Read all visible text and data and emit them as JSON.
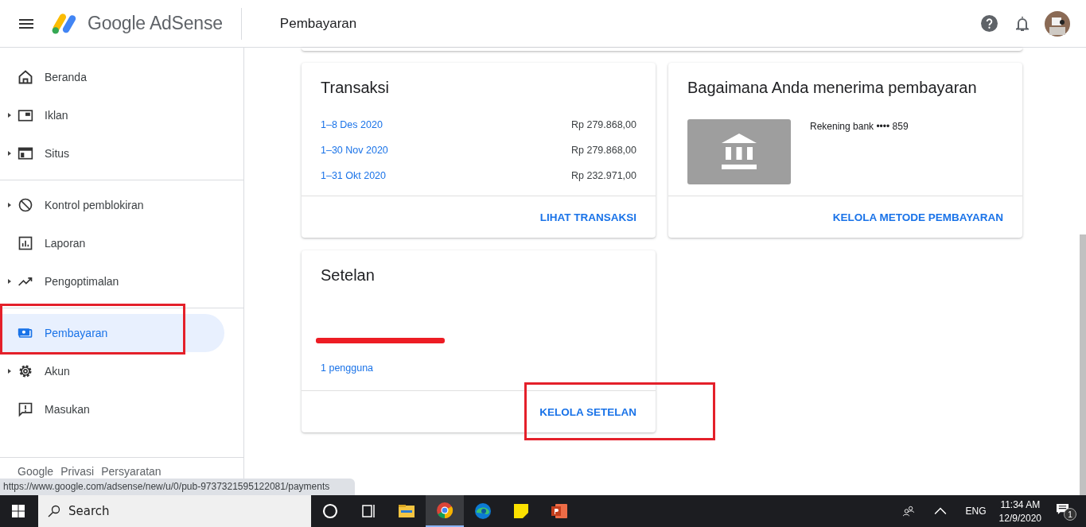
{
  "header": {
    "product": "Google AdSense",
    "page_title": "Pembayaran"
  },
  "sidebar": {
    "sections": [
      [
        {
          "label": "Beranda",
          "kind": "link",
          "selected": false,
          "highlighted": false
        },
        {
          "label": "Iklan",
          "kind": "group",
          "selected": false,
          "highlighted": false
        },
        {
          "label": "Situs",
          "kind": "group",
          "selected": false,
          "highlighted": false
        }
      ],
      [
        {
          "label": "Kontrol pemblokiran",
          "kind": "group",
          "selected": false,
          "highlighted": false
        },
        {
          "label": "Laporan",
          "kind": "link",
          "selected": false,
          "highlighted": false
        },
        {
          "label": "Pengoptimalan",
          "kind": "group",
          "selected": false,
          "highlighted": false
        }
      ],
      [
        {
          "label": "Pembayaran",
          "kind": "link",
          "selected": true,
          "highlighted": true
        },
        {
          "label": "Akun",
          "kind": "group",
          "selected": false,
          "highlighted": false
        },
        {
          "label": "Masukan",
          "kind": "link",
          "selected": false,
          "highlighted": false
        }
      ]
    ],
    "footer_links": [
      "Google",
      "Privasi",
      "Persyaratan"
    ]
  },
  "transactions": {
    "title": "Transaksi",
    "rows": [
      {
        "period": "1–8 Des 2020",
        "amount": "Rp 279.868,00"
      },
      {
        "period": "1–30 Nov 2020",
        "amount": "Rp 279.868,00"
      },
      {
        "period": "1–31 Okt 2020",
        "amount": "Rp 232.971,00"
      }
    ],
    "action": "LIHAT TRANSAKSI"
  },
  "payment_method": {
    "title": "Bagaimana Anda menerima pembayaran",
    "account": "Rekening bank •••• 859",
    "action": "KELOLA METODE PEMBAYARAN"
  },
  "settings": {
    "title": "Setelan",
    "redacted": true,
    "users_link": "1 pengguna",
    "action": "KELOLA SETELAN",
    "action_highlighted": true
  },
  "status_url": "https://www.google.com/adsense/new/u/0/pub-9737321595122081/payments",
  "taskbar": {
    "search": {
      "placeholder": "Search"
    },
    "apps": [
      {
        "selected": false
      },
      {
        "selected": false
      },
      {
        "selected": false
      },
      {
        "selected": true
      },
      {
        "selected": false
      },
      {
        "selected": false
      },
      {
        "selected": false
      }
    ],
    "language": "ENG",
    "time": "11:34 AM",
    "date": "12/9/2020",
    "notifications": "1"
  }
}
